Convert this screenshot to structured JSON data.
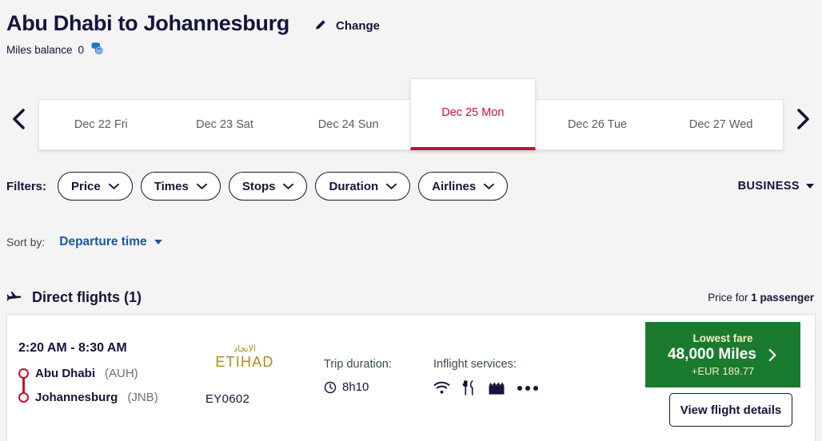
{
  "header": {
    "route_title": "Abu Dhabi to Johannesburg",
    "change_label": "Change",
    "change_icon": "pencil-icon",
    "miles_label": "Miles balance",
    "miles_value": "0",
    "miles_icon": "coins-icon"
  },
  "dates": {
    "prev_icon": "chevron-left-icon",
    "next_icon": "chevron-right-icon",
    "tabs": [
      {
        "label": "Dec 22 Fri",
        "selected": false
      },
      {
        "label": "Dec 23 Sat",
        "selected": false
      },
      {
        "label": "Dec 24 Sun",
        "selected": false
      },
      {
        "label": "Dec 25 Mon",
        "selected": true
      },
      {
        "label": "Dec 26 Tue",
        "selected": false
      },
      {
        "label": "Dec 27 Wed",
        "selected": false
      }
    ]
  },
  "filters": {
    "label": "Filters:",
    "items": [
      {
        "label": "Price"
      },
      {
        "label": "Times"
      },
      {
        "label": "Stops"
      },
      {
        "label": "Duration"
      },
      {
        "label": "Airlines"
      }
    ],
    "cabin_class": "BUSINESS"
  },
  "sort": {
    "label": "Sort by:",
    "value": "Departure time"
  },
  "section": {
    "icon": "airplane-icon",
    "title": "Direct flights (1)",
    "price_note_prefix": "Price for ",
    "price_note_strong": "1 passenger"
  },
  "flight": {
    "times": "2:20 AM - 8:30 AM",
    "origin_city": "Abu Dhabi",
    "origin_code": "(AUH)",
    "destination_city": "Johannesburg",
    "destination_code": "(JNB)",
    "airline_name": "ETIHAD",
    "airline_arabic": "الاتحاد",
    "flight_number": "EY0602",
    "duration_label": "Trip duration:",
    "duration_value": "8h10",
    "services_label": "Inflight services:",
    "services": [
      "wifi-icon",
      "meal-icon",
      "entertainment-icon",
      "more-icon"
    ],
    "fare_top": "Lowest fare",
    "fare_miles": "48,000 Miles",
    "fare_cash": "+EUR 189.77",
    "details_label": "View flight details"
  },
  "colors": {
    "navy": "#14143c",
    "red": "#c8102e",
    "green": "#1a7b2e",
    "blue": "#1a56a8",
    "gold": "#b08a22"
  }
}
